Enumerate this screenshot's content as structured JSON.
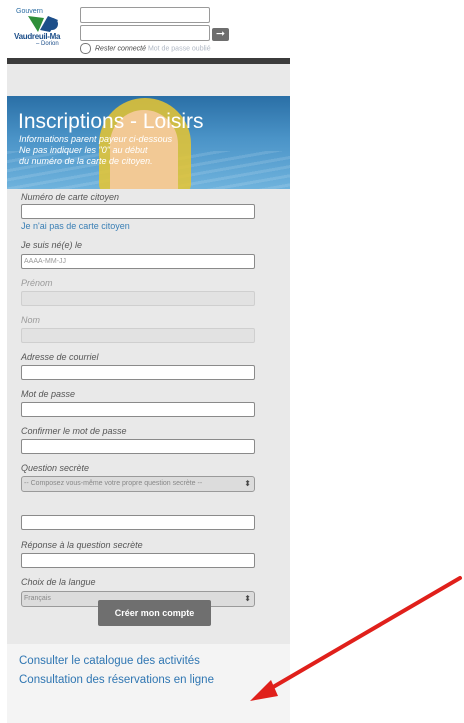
{
  "header": {
    "logo": {
      "top_text": "Gouvern",
      "main_text": "Vaudreuil-Ma",
      "sub_text": "– Dorion"
    },
    "login": {
      "remember_label": "Rester connecté",
      "forgot_label": "Mot de passe oublié",
      "submit_icon": "arrow-right-icon"
    }
  },
  "banner": {
    "title": "Inscriptions - Loisirs",
    "info_lines": [
      "Informations parent payeur ci-dessous",
      "Ne pas indiquer les \"0\" au début",
      "du numéro de la carte de citoyen."
    ]
  },
  "form": {
    "citizen_card_label": "Numéro de carte citoyen",
    "no_card_link": "Je n'ai pas de carte citoyen",
    "birth_label": "Je suis né(e) le",
    "birth_placeholder": "AAAA-MM-JJ",
    "firstname_label": "Prénom",
    "lastname_label": "Nom",
    "email_label": "Adresse de courriel",
    "password_label": "Mot de passe",
    "confirm_password_label": "Confirmer le mot de passe",
    "secret_question_label": "Question secrète",
    "secret_question_selected": "-- Composez vous-même votre propre question secrète --",
    "secret_answer_label": "Réponse à la question secrète",
    "language_label": "Choix de la langue",
    "language_selected": "Français",
    "submit_label": "Créer mon compte"
  },
  "footer": {
    "catalog_link": "Consulter le catalogue des activités",
    "reservations_link": "Consultation des réservations en ligne"
  },
  "colors": {
    "link": "#2f76b2",
    "annotation_arrow": "#e0201b",
    "button": "#6f6f6f"
  }
}
